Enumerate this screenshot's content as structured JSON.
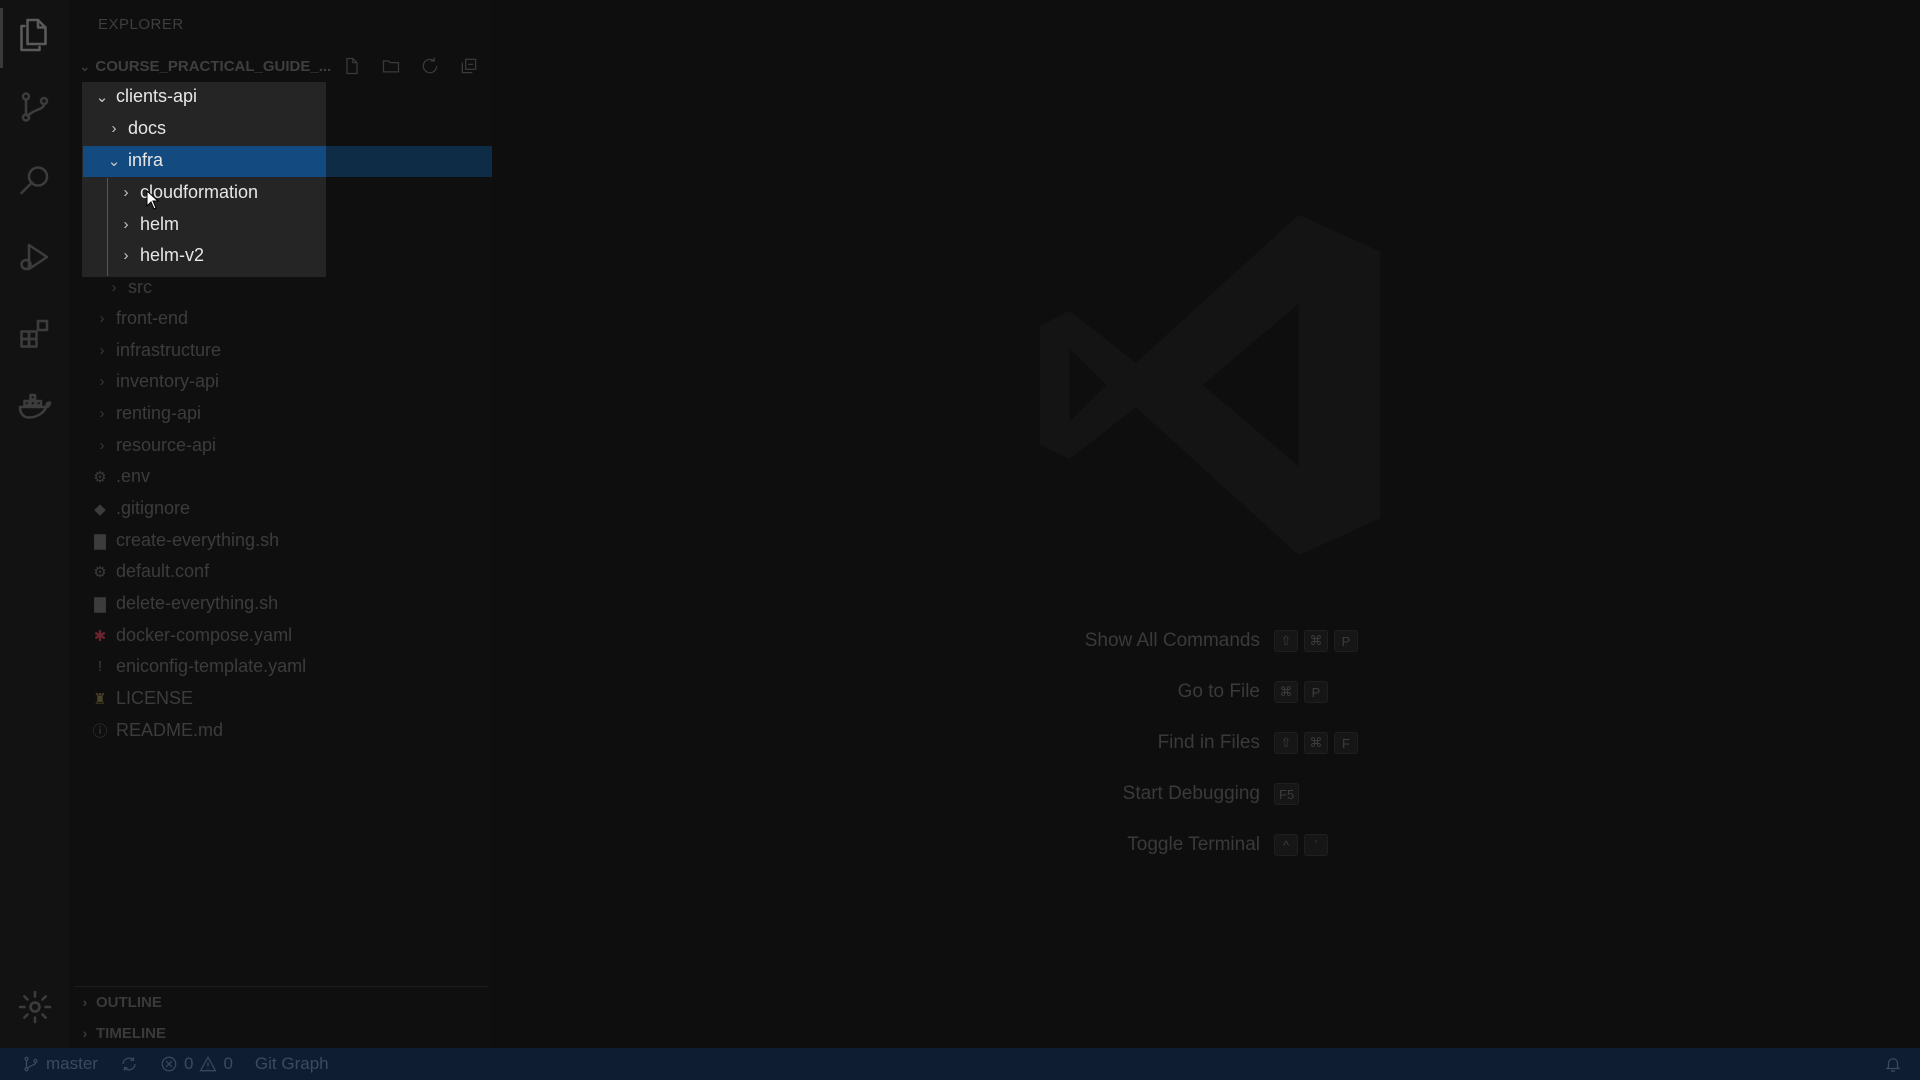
{
  "sidebar": {
    "title": "EXPLORER",
    "root_label": "COURSE_PRACTICAL_GUIDE_...",
    "root_actions": [
      {
        "name": "new-file-icon"
      },
      {
        "name": "new-folder-icon"
      },
      {
        "name": "refresh-icon"
      },
      {
        "name": "collapse-all-icon"
      }
    ],
    "tree": [
      {
        "label": "clients-api",
        "expanded": true
      },
      {
        "label": "docs"
      },
      {
        "label": "infra",
        "expanded": true
      },
      {
        "label": "cloudformation"
      },
      {
        "label": "helm"
      },
      {
        "label": "helm-v2"
      },
      {
        "label": "src"
      },
      {
        "label": "front-end"
      },
      {
        "label": "infrastructure"
      },
      {
        "label": "inventory-api"
      },
      {
        "label": "renting-api"
      },
      {
        "label": "resource-api"
      },
      {
        "label": ".env"
      },
      {
        "label": ".gitignore"
      },
      {
        "label": "create-everything.sh"
      },
      {
        "label": "default.conf"
      },
      {
        "label": "delete-everything.sh"
      },
      {
        "label": "docker-compose.yaml"
      },
      {
        "label": "eniconfig-template.yaml"
      },
      {
        "label": "LICENSE"
      },
      {
        "label": "README.md"
      }
    ],
    "outline_label": "OUTLINE",
    "timeline_label": "TIMELINE"
  },
  "editor": {
    "shortcuts": [
      {
        "label": "Show All Commands",
        "keys": [
          "⇧",
          "⌘",
          "P"
        ]
      },
      {
        "label": "Go to File",
        "keys": [
          "⌘",
          "P"
        ]
      },
      {
        "label": "Find in Files",
        "keys": [
          "⇧",
          "⌘",
          "F"
        ]
      },
      {
        "label": "Start Debugging",
        "keys": [
          "F5"
        ]
      },
      {
        "label": "Toggle Terminal",
        "keys": [
          "^",
          "`"
        ]
      }
    ]
  },
  "statusbar": {
    "branch": "master",
    "errors": "0",
    "warnings": "0",
    "git_graph": "Git Graph"
  },
  "colors": {
    "selection": "#134a80",
    "statusbar_bg": "#0f1d33",
    "yaml_icon": "#6b2330"
  }
}
